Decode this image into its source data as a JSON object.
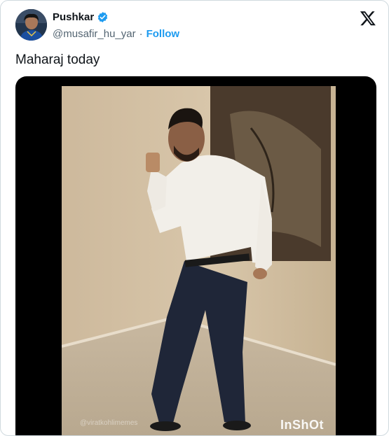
{
  "author": {
    "display_name": "Pushkar",
    "handle": "@musafir_hu_yar",
    "separator": "·",
    "follow_label": "Follow",
    "verified": true
  },
  "tweet": {
    "text": "Maharaj today"
  },
  "media": {
    "type": "video",
    "watermark": "InShOt",
    "credit": "@viratkohlimemes"
  },
  "colors": {
    "accent": "#1d9bf0",
    "text_primary": "#0f1419",
    "text_secondary": "#536471",
    "border": "#cfd9de"
  },
  "icons": {
    "logo": "x-logo-icon",
    "badge": "verified-badge-icon"
  }
}
